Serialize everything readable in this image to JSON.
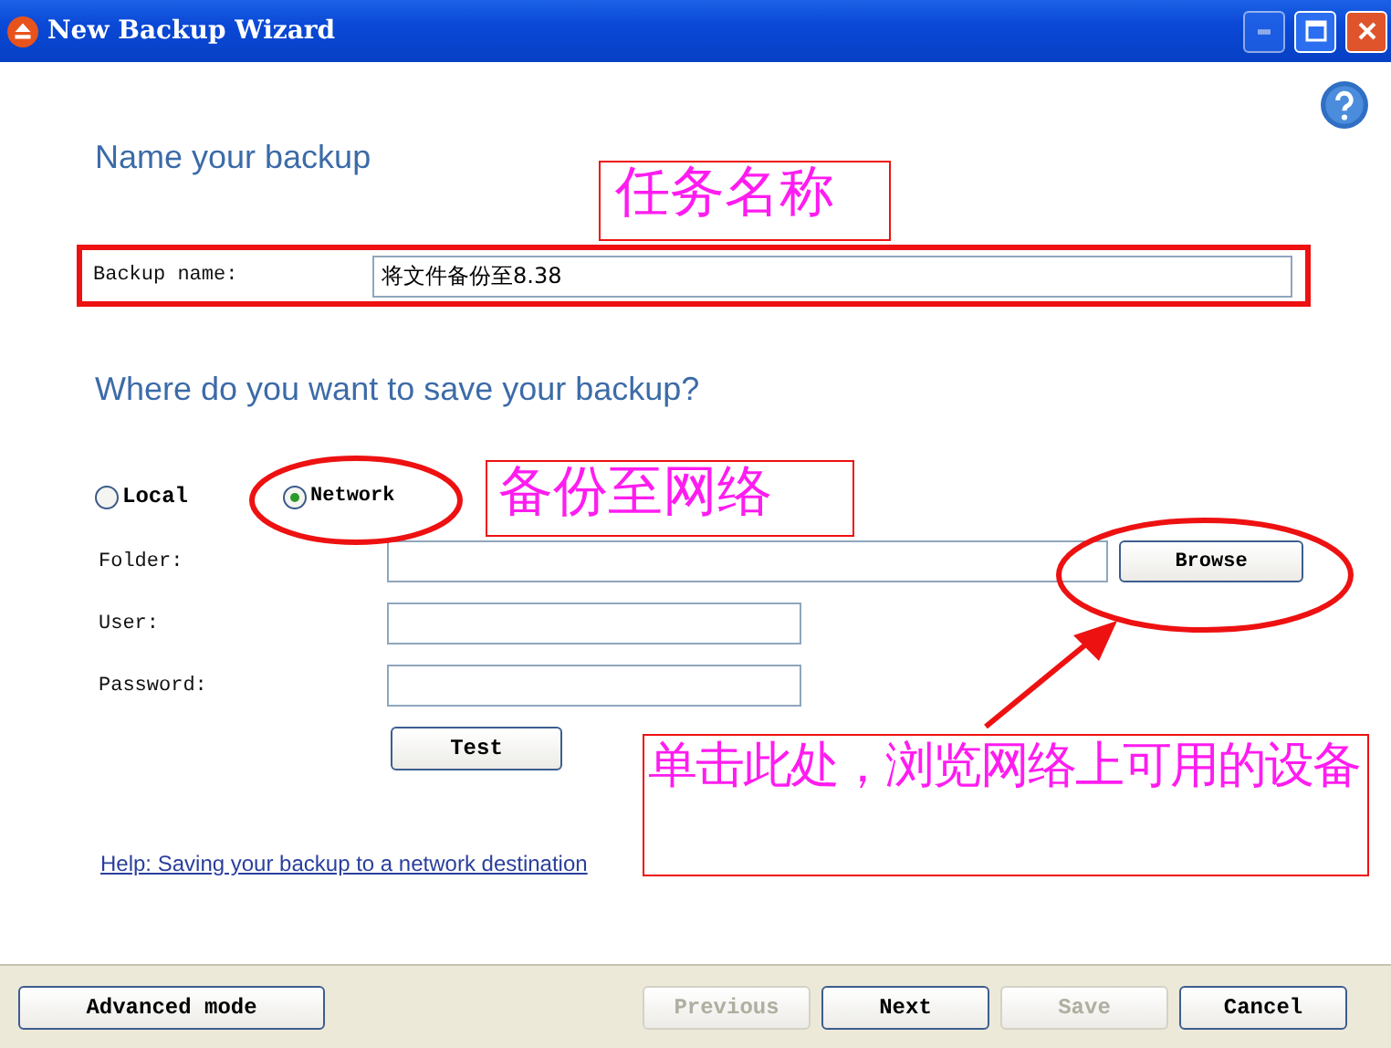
{
  "window": {
    "title": "New Backup Wizard"
  },
  "name_section": {
    "heading": "Name your backup",
    "label": "Backup name:",
    "value": "将文件备份至8.38"
  },
  "location_section": {
    "heading": "Where do you want to save your backup?",
    "options": [
      {
        "label": "Local",
        "selected": false
      },
      {
        "label": "Network",
        "selected": true
      }
    ],
    "fields": [
      {
        "label": "Folder:",
        "kind": "wide"
      },
      {
        "label": "User:",
        "kind": "short"
      },
      {
        "label": "Password:",
        "kind": "short"
      }
    ],
    "browse_button": "Browse",
    "test_button": "Test",
    "help_link": "Help: Saving your backup to a network destination"
  },
  "callouts": [
    "任务名称",
    "备份至网络",
    "单击此处，浏览网络上可用的设备"
  ],
  "footer": {
    "left_button": "Advanced mode",
    "buttons": [
      {
        "label": "Previous",
        "disabled": true
      },
      {
        "label": "Next",
        "disabled": false
      },
      {
        "label": "Save",
        "disabled": true
      },
      {
        "label": "Cancel",
        "disabled": false
      }
    ]
  }
}
